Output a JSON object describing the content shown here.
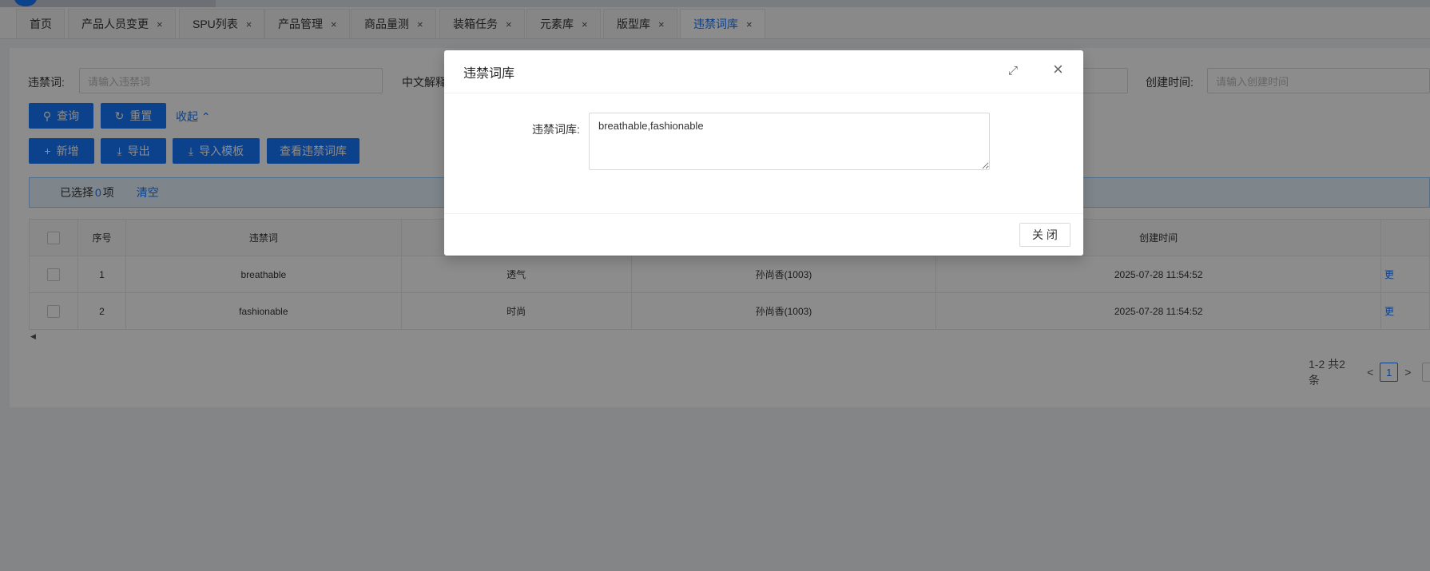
{
  "tabs": [
    {
      "label": "首页",
      "closable": false
    },
    {
      "label": "产品人员变更",
      "closable": true
    },
    {
      "label": "SPU列表",
      "closable": true
    },
    {
      "label": "产品管理",
      "closable": true
    },
    {
      "label": "商品量测",
      "closable": true
    },
    {
      "label": "装箱任务",
      "closable": true
    },
    {
      "label": "元素库",
      "closable": true
    },
    {
      "label": "版型库",
      "closable": true
    },
    {
      "label": "违禁词库",
      "closable": true,
      "active": true
    }
  ],
  "close_glyph": "×",
  "search": {
    "word_label": "违禁词:",
    "word_placeholder": "请输入违禁词",
    "cn_label": "中文解释",
    "created_label": "创建时间:",
    "created_placeholder": "请输入创建时间",
    "query_btn": "查询",
    "reset_btn": "重置",
    "collapse_link": "收起"
  },
  "toolbar": {
    "add": "新增",
    "export": "导出",
    "import_tpl": "导入模板",
    "view_lib": "查看违禁词库"
  },
  "alert": {
    "prefix": "已选择",
    "count": "0",
    "suffix": "项",
    "clear": "清空"
  },
  "table": {
    "headers": {
      "index": "序号",
      "word": "违禁词",
      "created_at": "创建时间"
    },
    "rows": [
      {
        "index": "1",
        "word": "breathable",
        "cn": "透气",
        "creator": "孙尚香(1003)",
        "created_at": "2025-07-28 11:54:52",
        "op": "更"
      },
      {
        "index": "2",
        "word": "fashionable",
        "cn": "时尚",
        "creator": "孙尚香(1003)",
        "created_at": "2025-07-28 11:54:52",
        "op": "更"
      }
    ]
  },
  "pager": {
    "summary": "1-2 共2条",
    "current": "1"
  },
  "modal": {
    "title": "违禁词库",
    "field_label": "违禁词库:",
    "field_value": "breathable,fashionable",
    "close_btn": "关 闭"
  },
  "colors": {
    "primary": "#1677ff",
    "mask": "rgba(0,0,0,0.45)"
  }
}
